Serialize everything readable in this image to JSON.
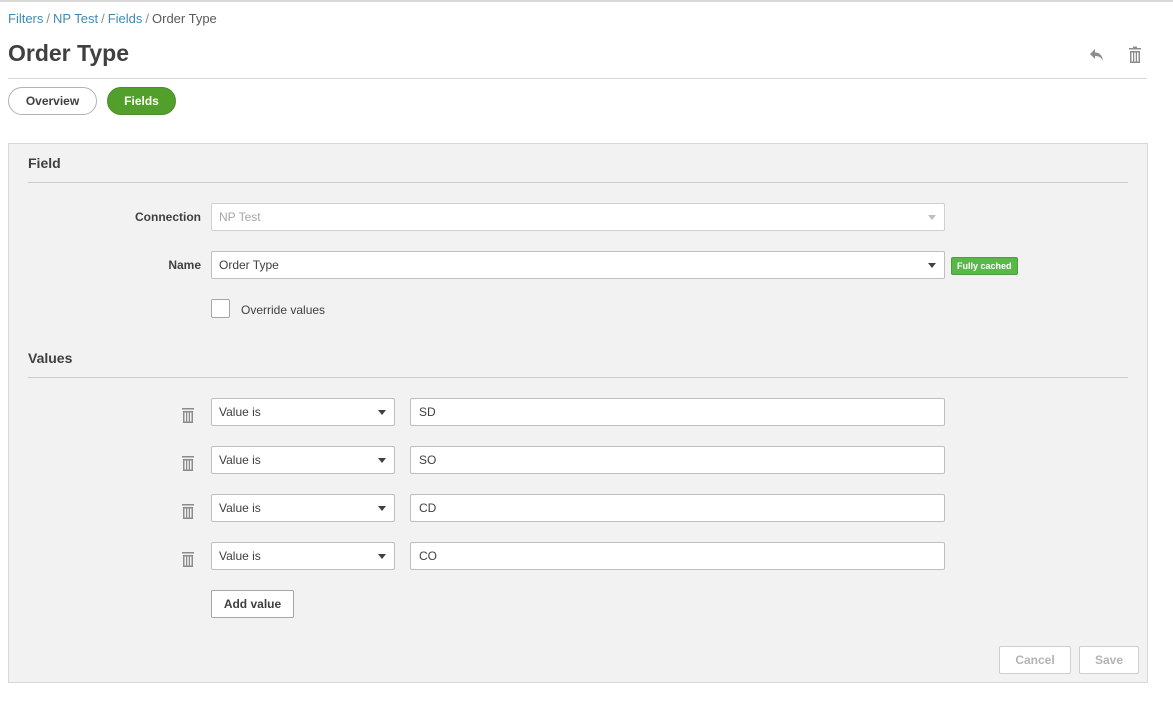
{
  "breadcrumb": {
    "items": [
      "Filters",
      "NP Test",
      "Fields"
    ],
    "current": "Order Type",
    "separator": "/"
  },
  "page": {
    "title": "Order Type"
  },
  "header_icons": {
    "undo": "undo-icon",
    "delete": "trash-icon"
  },
  "tabs": [
    {
      "label": "Overview",
      "active": false
    },
    {
      "label": "Fields",
      "active": true
    }
  ],
  "field_section": {
    "title": "Field",
    "connection_label": "Connection",
    "connection_value": "NP Test",
    "name_label": "Name",
    "name_value": "Order Type",
    "cache_badge": "Fully cached",
    "override_label": "Override values",
    "override_checked": false
  },
  "values_section": {
    "title": "Values",
    "rows": [
      {
        "operator": "Value is",
        "value": "SD"
      },
      {
        "operator": "Value is",
        "value": "SO"
      },
      {
        "operator": "Value is",
        "value": "CD"
      },
      {
        "operator": "Value is",
        "value": "CO"
      }
    ],
    "add_label": "Add value"
  },
  "footer": {
    "cancel_label": "Cancel",
    "save_label": "Save"
  },
  "colors": {
    "accent_green": "#52a02b",
    "badge_green": "#5ab84b",
    "link_blue": "#3f8ab3",
    "panel_bg": "#f2f2f2"
  }
}
